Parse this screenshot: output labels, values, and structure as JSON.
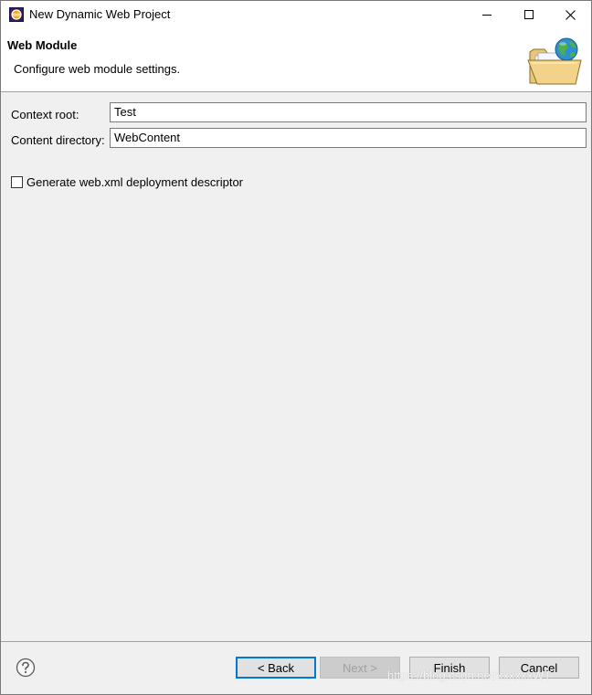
{
  "window": {
    "title": "New Dynamic Web Project",
    "controls": {
      "minimize": "minimize-icon",
      "maximize": "maximize-icon",
      "close": "close-icon"
    }
  },
  "banner": {
    "title": "Web Module",
    "description": "Configure web module settings.",
    "icon": "web-folder-globe-icon"
  },
  "form": {
    "context_root_label": "Context root:",
    "context_root_value": "Test",
    "content_directory_label": "Content directory:",
    "content_directory_value": "WebContent",
    "generate_descriptor_label": "Generate web.xml deployment descriptor",
    "generate_descriptor_checked": false
  },
  "footer": {
    "help_icon": "help-icon",
    "back_label": "< Back",
    "next_label": "Next >",
    "finish_label": "Finish",
    "cancel_label": "Cancel",
    "watermark": "https://blog.csdn.net/xxxxxxWT"
  },
  "colors": {
    "dialog_bg": "#f0f0f0",
    "focus_border": "#0078d7",
    "disabled_text": "#a0a0a0"
  }
}
